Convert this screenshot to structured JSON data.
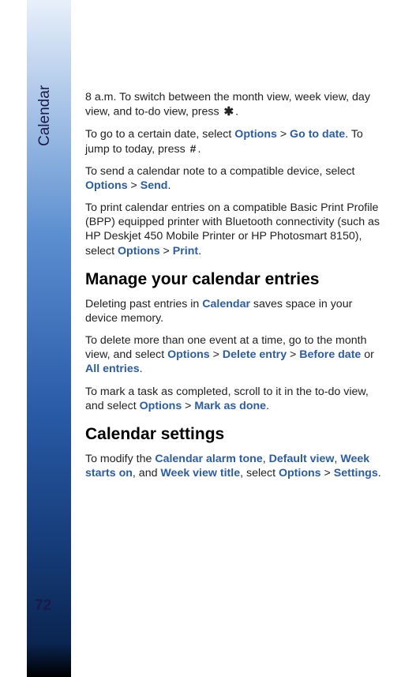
{
  "sidebar": {
    "section": "Calendar",
    "page": "72"
  },
  "body": {
    "p1a": "8 a.m. To switch between the month view, week view, day view, and to-do view, press ",
    "p1b": ".",
    "p2a": "To go to a certain date, select ",
    "p2_opt": "Options",
    "p2_gt1": " > ",
    "p2_goto": "Go to date",
    "p2b": ". To jump to today, press ",
    "p2c": ".",
    "p3a": "To send a calendar note to a compatible device, select ",
    "p3_opt": "Options",
    "p3_gt": " > ",
    "p3_send": "Send",
    "p3b": ".",
    "p4a": "To print calendar entries on a compatible Basic Print Profile (BPP) equipped printer with Bluetooth connectivity (such as HP Deskjet 450 Mobile Printer or HP Photosmart 8150), select ",
    "p4_opt": "Options",
    "p4_gt": " > ",
    "p4_print": "Print",
    "p4b": ".",
    "h1": "Manage your calendar entries",
    "p5a": "Deleting past entries in ",
    "p5_cal": "Calendar",
    "p5b": " saves space in your device memory.",
    "p6a": "To delete more than one event at a time, go to the month view, and select ",
    "p6_opt": "Options",
    "p6_gt1": " > ",
    "p6_del": "Delete entry",
    "p6_gt2": " > ",
    "p6_before": "Before date",
    "p6_or": " or ",
    "p6_all": "All entries",
    "p6b": ".",
    "p7a": "To mark a task as completed, scroll to it in the to-do view, and select ",
    "p7_opt": "Options",
    "p7_gt": " > ",
    "p7_mark": "Mark as done",
    "p7b": ".",
    "h2": "Calendar settings",
    "p8a": "To modify the ",
    "p8_tone": "Calendar alarm tone",
    "p8_c1": ", ",
    "p8_view": "Default view",
    "p8_c2": ", ",
    "p8_week": "Week starts on",
    "p8_c3": ", and ",
    "p8_title": "Week view title",
    "p8_c4": ", select ",
    "p8_opt": "Options",
    "p8_gt": " > ",
    "p8_set": "Settings",
    "p8b": "."
  }
}
